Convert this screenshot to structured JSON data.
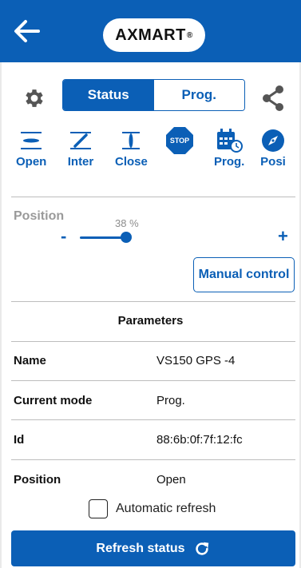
{
  "header": {
    "logo_text": "AXMART",
    "logo_mark": "®",
    "back_icon": "arrow-left-icon"
  },
  "tabs": [
    {
      "label": "Status",
      "active": true
    },
    {
      "label": "Prog.",
      "active": false
    }
  ],
  "actions": [
    {
      "label": "Open",
      "icon": "valve-open-icon"
    },
    {
      "label": "Inter",
      "icon": "valve-intermediate-icon"
    },
    {
      "label": "Close",
      "icon": "valve-close-icon"
    },
    {
      "label": "",
      "icon": "stop-sign-icon",
      "icon_text": "STOP"
    },
    {
      "label": "Prog.",
      "icon": "calendar-clock-icon"
    },
    {
      "label": "Posi",
      "icon": "compass-icon"
    }
  ],
  "position": {
    "label": "Position",
    "value_text": "38 %",
    "value": 38,
    "minus": "-",
    "plus": "+"
  },
  "manual_control": "Manual control",
  "parameters": {
    "title": "Parameters",
    "rows": [
      {
        "label": "Name",
        "value": "VS150 GPS -4"
      },
      {
        "label": "Current mode",
        "value": "Prog."
      },
      {
        "label": "Id",
        "value": "88:6b:0f:7f:12:fc"
      },
      {
        "label": "Position",
        "value": "Open"
      }
    ]
  },
  "auto_refresh": {
    "label": "Automatic refresh",
    "checked": false
  },
  "refresh_button": "Refresh status",
  "colors": {
    "primary": "#0b5fb6",
    "muted": "#9a9a9a",
    "divider": "#bdbdbd",
    "stop": "#0b5fb6"
  }
}
